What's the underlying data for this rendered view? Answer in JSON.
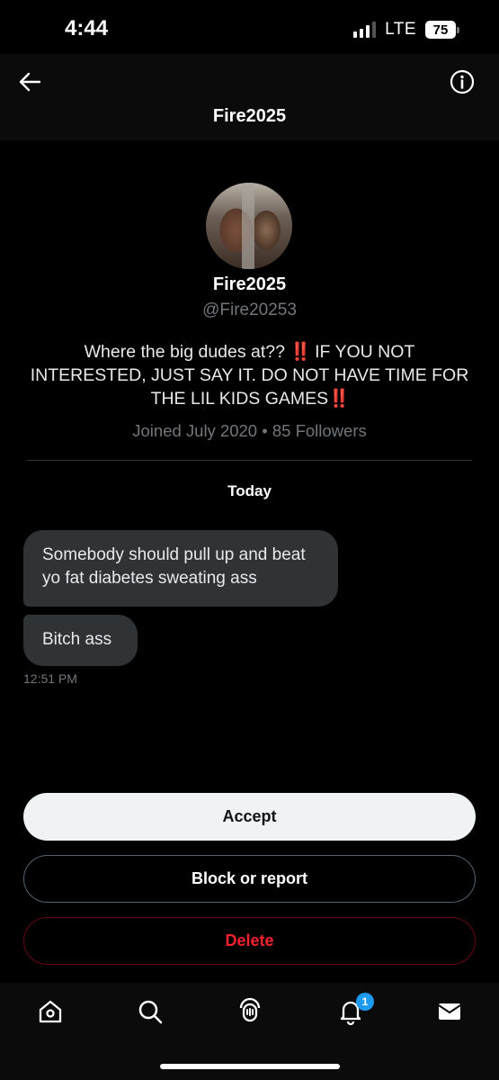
{
  "status_bar": {
    "time": "4:44",
    "network": "LTE",
    "battery": "75"
  },
  "header": {
    "title": "Fire2025"
  },
  "profile": {
    "name": "Fire2025",
    "handle": "@Fire20253",
    "bio_part1": "Where the big dudes at?? ",
    "bio_emoji1": "‼️",
    "bio_part2": " IF YOU NOT INTERESTED, JUST SAY IT. DO NOT HAVE TIME FOR THE LIL KIDS GAMES",
    "bio_emoji2": "‼️",
    "joined": "Joined July 2020 • 85 Followers"
  },
  "conversation": {
    "date_label": "Today",
    "messages": [
      {
        "text": "Somebody should pull up and beat yo fat diabetes sweating ass"
      },
      {
        "text": "Bitch ass"
      }
    ],
    "last_time": "12:51 PM"
  },
  "actions": {
    "accept": "Accept",
    "block": "Block or report",
    "delete": "Delete"
  },
  "nav": {
    "items": [
      "home-icon",
      "search-icon",
      "grok-icon",
      "bell-icon",
      "mail-icon"
    ],
    "notification_count": "1"
  },
  "colors": {
    "accent": "#1d9bf0",
    "danger": "#f4212e",
    "bubble": "#2f3336",
    "muted": "#71767b"
  }
}
